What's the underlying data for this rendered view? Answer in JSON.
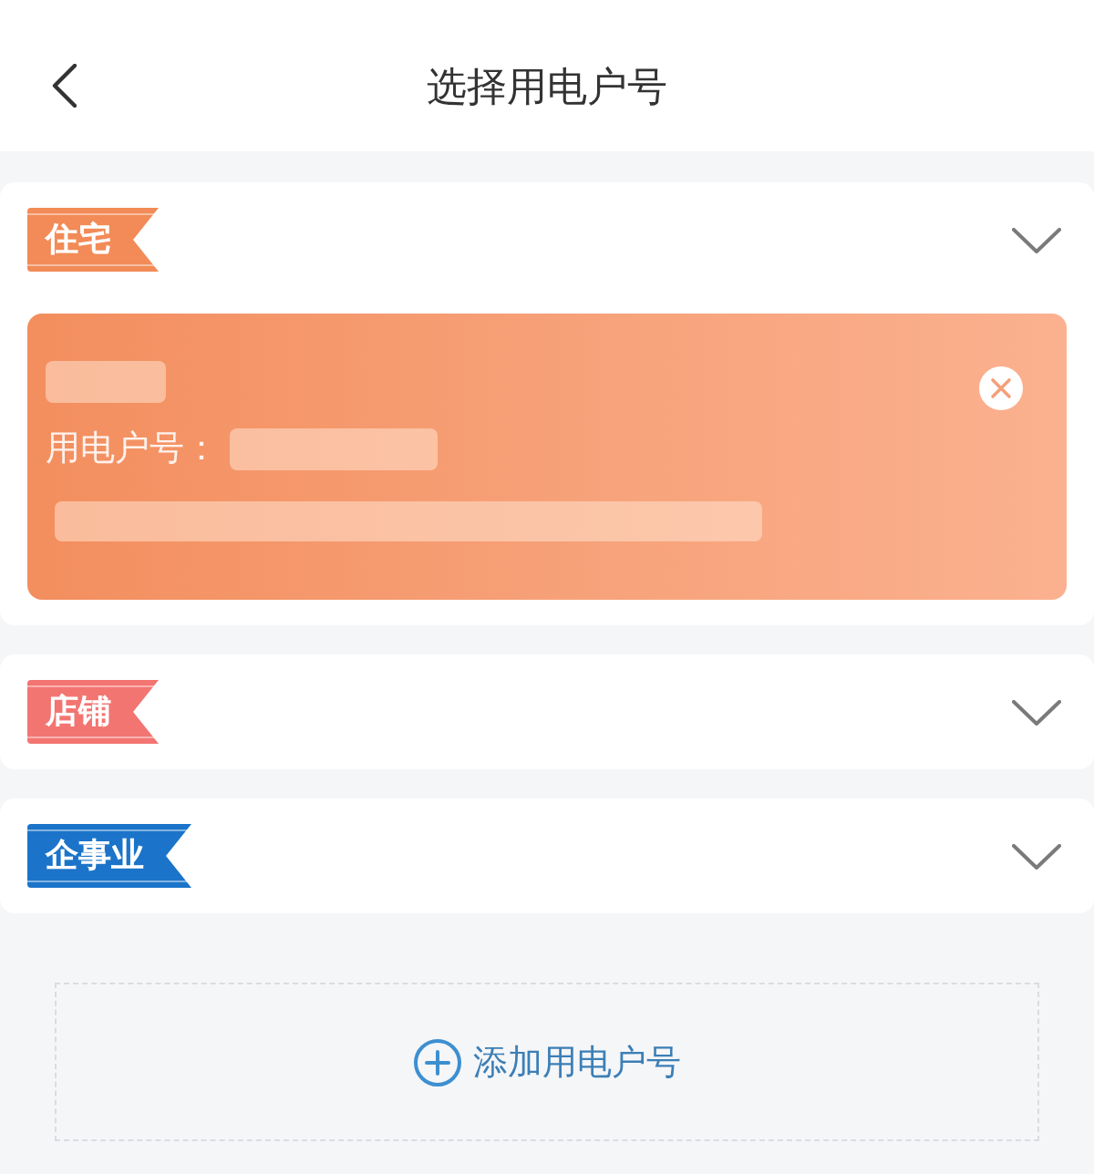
{
  "header": {
    "title": "选择用电户号"
  },
  "sections": [
    {
      "label": "住宅",
      "color": "#f28b57",
      "accounts": [
        {
          "number_label": "用电户号："
        }
      ]
    },
    {
      "label": "店铺",
      "color": "#f27572"
    },
    {
      "label": "企事业",
      "color": "#1b74c9"
    }
  ],
  "add_button": {
    "label": "添加用电户号"
  }
}
